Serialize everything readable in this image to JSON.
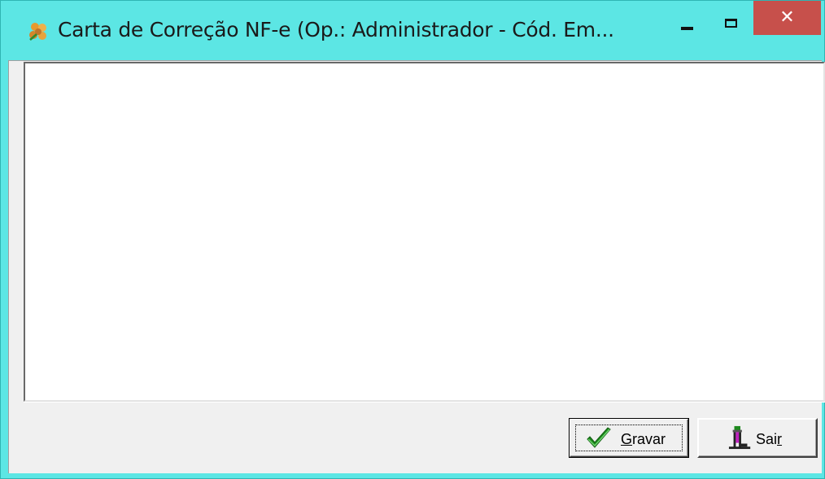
{
  "window": {
    "title": "Carta de Correção NF-e (Op.: Administrador - Cód. Em...",
    "controls": {
      "minimize_icon": "minimize-icon",
      "maximize_icon": "maximize-icon",
      "close_glyph": "✕"
    }
  },
  "memo": {
    "value": ""
  },
  "buttons": {
    "gravar": {
      "prefix": "",
      "mnemonic": "G",
      "rest": "ravar",
      "icon": "checkmark-icon"
    },
    "sair": {
      "prefix": "Sai",
      "mnemonic": "r",
      "rest": "",
      "icon": "exit-door-icon"
    }
  },
  "colors": {
    "titlebar": "#5ce6e4",
    "close_button": "#c7504b",
    "client_background": "#f0f0f0"
  }
}
